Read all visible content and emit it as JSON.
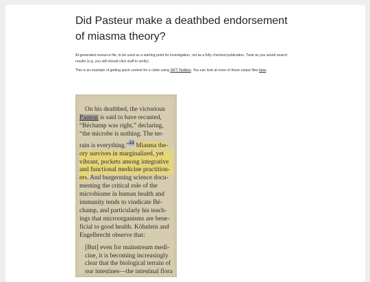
{
  "title": "Did Pasteur make a deathbed endorsement of miasma theory?",
  "intro": "AI-generated resource file, to be used as a starting point for investigation, not as a fully checked publication. Treat as you would search results (e.g. you still should click stuff to verify).",
  "context": {
    "before": "This is an example of getting quick context for a claim using ",
    "toolbox_link": "SIFT Toolbox",
    "middle": ". You can look at more of these output files ",
    "here_link": "here",
    "after": "."
  },
  "scan": {
    "lines": [
      "On his deathbed, the victorious",
      "is said to have recanted,",
      "“Béchamp was right,” declaring,",
      "“the microbe is nothing. The ter-",
      "rain is everything.”",
      "ory survives in marginalized, yet",
      "vibrant, pockets among integrative",
      "and functional medicine practition-",
      "ers.",
      "menting the critical role of the",
      "microbiome in human health and",
      "immunity tends to vindicate Bé-",
      "champ, and particularly his teach-",
      "ings that microorganisms are bene-",
      "ficial to good health. Köhnlein and",
      "Engelbrecht observe that:"
    ],
    "pasteur": "Pasteur",
    "footnote": "44",
    "miasma_start": "Miasma the-",
    "burgeoning": " And burgeoning science docu-",
    "quote_lines": [
      "[But] even for mainstream medi-",
      "cine, it is becoming increasingly",
      "clear that the biological terrain of",
      "our intestines—the intestinal flora"
    ]
  }
}
